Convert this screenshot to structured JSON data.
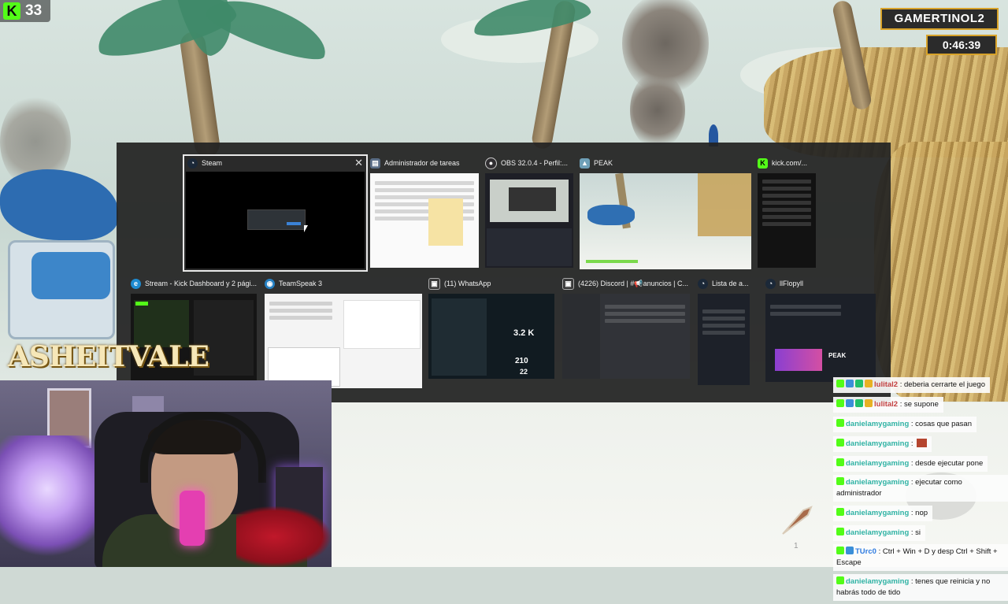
{
  "overlay": {
    "viewer_count": "33",
    "streamer_name": "GAMERTINOL2",
    "stream_timer": "0:46:39",
    "game_logo": "ASHEITVALE",
    "hud_counter": "1"
  },
  "switcher": {
    "top_row": [
      {
        "title": "Steam",
        "icon": "steam-icon",
        "selected": true
      },
      {
        "title": "Administrador de tareas",
        "icon": "task-manager-icon"
      },
      {
        "title": "OBS 32.0.4 - Perfil:...",
        "icon": "obs-icon"
      },
      {
        "title": "PEAK",
        "icon": "peak-icon"
      },
      {
        "title": "kick.com/...",
        "icon": "kick-icon"
      }
    ],
    "bottom_row": [
      {
        "title": "Stream - Kick Dashboard y 2 pági...",
        "icon": "edge-icon"
      },
      {
        "title": "TeamSpeak 3",
        "icon": "teamspeak-icon"
      },
      {
        "title": "(11) WhatsApp",
        "icon": "whatsapp-icon"
      },
      {
        "title": "(4226) Discord | #📢anuncios | C...",
        "icon": "discord-icon"
      },
      {
        "title": "Lista de a...",
        "icon": "steam-icon"
      },
      {
        "title": "llFlopyll",
        "icon": "steam-icon"
      }
    ],
    "whatsapp_stat": "3.2 K",
    "whatsapp_stat2": "210",
    "whatsapp_stat3": "22",
    "peak_label": "PEAK"
  },
  "chat": {
    "messages": [
      {
        "user": "lulital2",
        "text": ": deberia cerrarte el juego",
        "badges": [
          "kick",
          "blue",
          "green",
          "gold"
        ]
      },
      {
        "user": "lulital2",
        "text": ": se supone",
        "badges": [
          "kick",
          "blue",
          "green",
          "gold"
        ]
      },
      {
        "user": "danielamygaming",
        "text": ": cosas que pasan",
        "badges": [
          "kick"
        ]
      },
      {
        "user": "danielamygaming",
        "text": ":",
        "badges": [
          "kick"
        ],
        "emote": true
      },
      {
        "user": "danielamygaming",
        "text": ": desde ejecutar pone",
        "badges": [
          "kick"
        ]
      },
      {
        "user": "danielamygaming",
        "text": ": ejecutar como administrador",
        "badges": [
          "kick"
        ]
      },
      {
        "user": "danielamygaming",
        "text": ": nop",
        "badges": [
          "kick"
        ]
      },
      {
        "user": "danielamygaming",
        "text": ": si",
        "badges": [
          "kick"
        ]
      },
      {
        "user": "TUrc0",
        "text": ": Ctrl + Win + D y desp Ctrl + Shift + Escape",
        "badges": [
          "kick",
          "blue"
        ]
      },
      {
        "user": "danielamygaming",
        "text": ": tenes que reinicia y no habrás todo de tido",
        "badges": [
          "kick"
        ]
      }
    ],
    "colors": {
      "user_a": "#c23f3f",
      "user_b": "#2fb2a4",
      "user_c": "#2e7be0"
    }
  },
  "colors": {
    "kick_green": "#53fc18",
    "accent_gold": "#d8a32a",
    "switcher_bg": "#222222"
  }
}
